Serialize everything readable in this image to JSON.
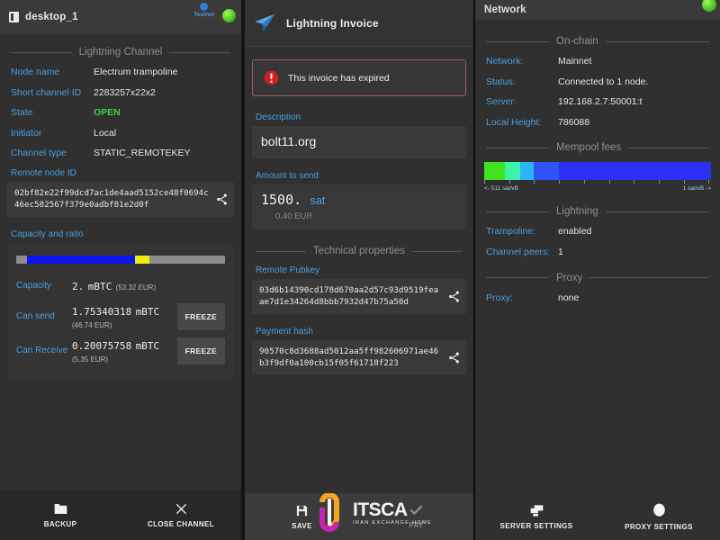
{
  "left_panel": {
    "header": {
      "title": "desktop_1",
      "wallet_icon": "wallet-icon",
      "testnet_label": "Testnet",
      "testnet_icon": "testnet-indicator-icon",
      "status_icon": "connection-status-dot"
    },
    "section_title": "Lightning Channel",
    "rows": [
      {
        "key": "Node name",
        "value": "Electrum trampoline"
      },
      {
        "key": "Short channel ID",
        "value": "2283257x22x2"
      },
      {
        "key": "State",
        "value": "OPEN"
      },
      {
        "key": "Initiator",
        "value": "Local"
      },
      {
        "key": "Channel type",
        "value": "STATIC_REMOTEKEY"
      }
    ],
    "remote_node_id_label": "Remote node ID",
    "remote_node_id": "02bf82e22f99dcd7ac1de4aad5152ce48f0694c46ec582567f379e0adbf81e2d0f",
    "capacity_label": "Capacity and ratio",
    "capacity_bar": {
      "segments": [
        {
          "name": "reserve-left",
          "color": "#8c8c8c",
          "pct": 5
        },
        {
          "name": "can-send",
          "color": "#0b16ef",
          "pct": 52
        },
        {
          "name": "pending",
          "color": "#f2ed0c",
          "pct": 7
        },
        {
          "name": "can-receive",
          "color": "#8c8c8c",
          "pct": 36
        }
      ]
    },
    "amounts": [
      {
        "key": "Capacity",
        "value": "2.",
        "unit": "mBTC",
        "fiat": "(53.32 EUR)",
        "inline_fiat": true,
        "freeze": null
      },
      {
        "key": "Can send",
        "value": "1.75340318",
        "unit": "mBTC",
        "fiat": "(46.74 EUR)",
        "inline_fiat": false,
        "freeze": "FREEZE"
      },
      {
        "key": "Can Receive",
        "value": "0.20075758",
        "unit": "mBTC",
        "fiat": "(5.35 EUR)",
        "inline_fiat": false,
        "freeze": "FREEZE"
      }
    ],
    "actions": [
      {
        "label": "BACKUP",
        "icon": "backup-folder-icon"
      },
      {
        "label": "CLOSE CHANNEL",
        "icon": "close-x-icon"
      }
    ]
  },
  "mid_panel": {
    "header": {
      "title": "Lightning Invoice",
      "icon": "paper-plane-icon"
    },
    "alert": {
      "message": "This invoice has expired",
      "icon": "error-exclamation-icon",
      "border_color": "#a85b5b"
    },
    "description_label": "Description",
    "description_value": "bolt11.org",
    "amount_label": "Amount to send",
    "amount_value": "1500.",
    "amount_unit": "sat",
    "amount_fiat": "0.40  EUR",
    "section_title": "Technical properties",
    "remote_pubkey_label": "Remote Pubkey",
    "remote_pubkey": "03d6b14390cd178d670aa2d57c93d9519feaae7d1e34264d8bbb7932d47b75a50d",
    "payment_hash_label": "Payment hash",
    "payment_hash": "90570c8d3688ad5012aa5ff982606971ae46b3f9df0a100cb15f05f61718f223",
    "actions": [
      {
        "label": "SAVE",
        "icon": "save-floppy-icon",
        "disabled": false
      },
      {
        "label": "PAY",
        "icon": "pay-check-icon",
        "disabled": true
      }
    ]
  },
  "right_panel": {
    "header": {
      "title": "Network",
      "status_icon": "connection-status-dot"
    },
    "onchain_title": "On-chain",
    "onchain_rows": [
      {
        "key": "Network:",
        "value": "Mainnet"
      },
      {
        "key": "Status:",
        "value": "Connected to 1 node."
      },
      {
        "key": "Server:",
        "value": "192.168.2.7:50001:t"
      },
      {
        "key": "Local Height:",
        "value": "786088"
      }
    ],
    "mempool_title": "Mempool fees",
    "mempool": {
      "left_label": "<- 511 sat/vB",
      "right_label": "1 sat/vB ->",
      "segments": [
        {
          "color": "#41e321",
          "pct": 9
        },
        {
          "color": "#3cf2a8",
          "pct": 7
        },
        {
          "color": "#2fb4f7",
          "pct": 6
        },
        {
          "color": "#2f52f7",
          "pct": 11
        },
        {
          "color": "#2b30f4",
          "pct": 67
        }
      ]
    },
    "lightning_title": "Lightning",
    "lightning_rows": [
      {
        "key": "Trampoline:",
        "value": "enabled"
      },
      {
        "key": "Channel peers:",
        "value": "1"
      }
    ],
    "proxy_title": "Proxy",
    "proxy_rows": [
      {
        "key": "Proxy:",
        "value": "none"
      }
    ],
    "actions": [
      {
        "label": "SERVER SETTINGS",
        "icon": "server-icon"
      },
      {
        "label": "PROXY SETTINGS",
        "icon": "proxy-circle-icon"
      }
    ]
  },
  "watermark": {
    "main": "ITSCA",
    "sub": "IRAN EXCHANGE HOME",
    "icon": "itsca-logo-icon"
  }
}
